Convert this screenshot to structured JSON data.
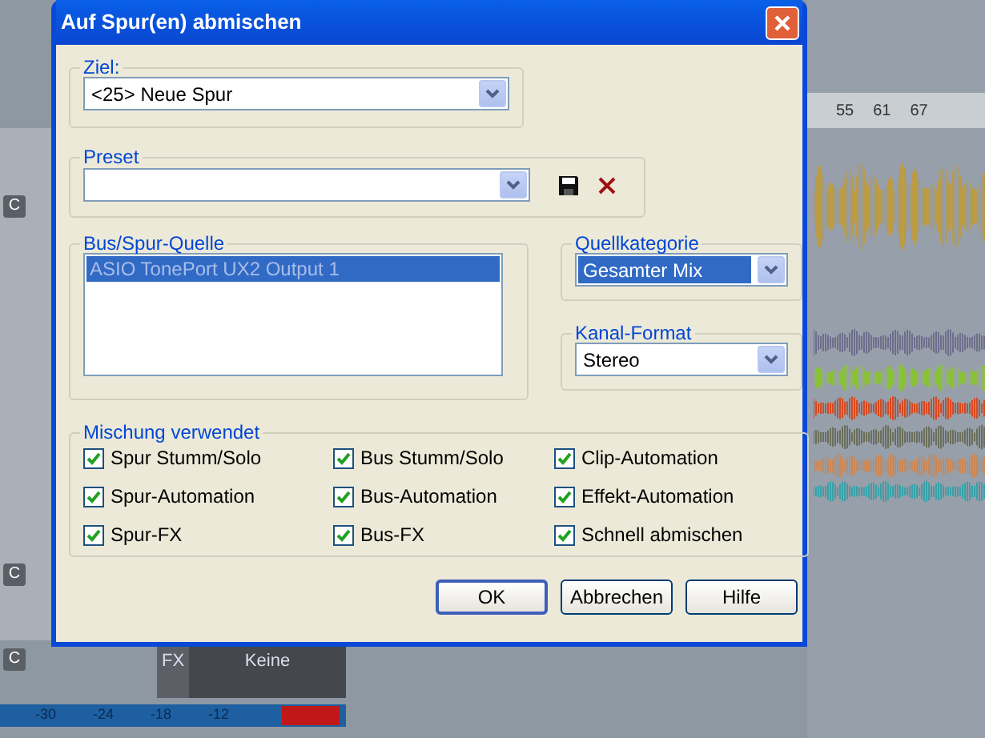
{
  "background": {
    "ruler": [
      "55",
      "61",
      "67"
    ],
    "track_buttons": [
      "C",
      "C",
      "C"
    ],
    "tracks": [
      {
        "color": "#b89a48"
      },
      {
        "color": "#6e6e8c"
      },
      {
        "color": "#8cc040"
      },
      {
        "color": "#d44a22"
      },
      {
        "color": "#6a6e5c"
      },
      {
        "color": "#c8885a"
      },
      {
        "color": "#3aa0a8"
      }
    ],
    "fx_label": "FX",
    "fx_value": "Keine",
    "meter_scale": [
      "-30",
      "-24",
      "-18",
      "-12"
    ]
  },
  "dialog": {
    "title": "Auf Spur(en) abmischen",
    "target": {
      "label": "Ziel:",
      "value": "<25> Neue Spur"
    },
    "preset": {
      "label": "Preset"
    },
    "source": {
      "label": "Bus/Spur-Quelle",
      "items": [
        {
          "label": "ASIO TonePort UX2 Output 1",
          "selected": true
        }
      ]
    },
    "source_category": {
      "label": "Quellkategorie",
      "value": "Gesamter Mix",
      "focused": true
    },
    "channel_format": {
      "label": "Kanal-Format",
      "value": "Stereo",
      "focused": false
    },
    "mix": {
      "label": "Mischung verwendet",
      "options": [
        {
          "label": "Spur Stumm/Solo",
          "checked": true
        },
        {
          "label": "Bus Stumm/Solo",
          "checked": true
        },
        {
          "label": "Clip-Automation",
          "checked": true
        },
        {
          "label": "Spur-Automation",
          "checked": true
        },
        {
          "label": "Bus-Automation",
          "checked": true
        },
        {
          "label": "Effekt-Automation",
          "checked": true
        },
        {
          "label": "Spur-FX",
          "checked": true
        },
        {
          "label": "Bus-FX",
          "checked": true
        },
        {
          "label": "Schnell abmischen",
          "checked": true
        }
      ]
    },
    "buttons": [
      {
        "label": "OK",
        "default": true
      },
      {
        "label": "Abbrechen",
        "default": false
      },
      {
        "label": "Hilfe",
        "default": false
      }
    ]
  }
}
